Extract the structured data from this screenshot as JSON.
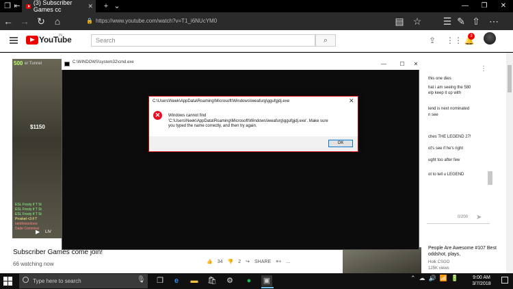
{
  "browser": {
    "tab_title": "(3) Subscriber Games cc",
    "tab_close": "✕",
    "url": "https://www.youtube.com/watch?v=T1_i6NUcYM0",
    "icons": [
      "back-icon",
      "forward-icon",
      "refresh-icon",
      "home-icon",
      "reading-view-icon",
      "favorites-icon",
      "favorites-hub-icon",
      "pen-icon",
      "share-icon",
      "more-icon"
    ]
  },
  "youtube": {
    "logo_text": "YouTube",
    "region": "IN",
    "search_placeholder": "Search",
    "notification_count": "3",
    "video_title": "Subscriber Games come join!",
    "watching": "66 watching now",
    "likes": "34",
    "dislikes": "2",
    "share_label": "SHARE",
    "more": "...",
    "overlay": {
      "tag": "500",
      "corner": "er Tunnel",
      "money": "$1150",
      "live": "LIV",
      "killfeed": [
        "ESL Frosty if T St",
        "ESL Frosty if T St",
        "ESL Frosty if T St",
        "Prosket <3 if T",
        "iamthesoolooo",
        "Dade Commissi"
      ]
    },
    "chat": {
      "lines": [
        "this one dies",
        "hat i am seeing the 580",
        "elp keep it up with",
        "lend is next nominated",
        "n see",
        "ches THE LEGEND 27!",
        "ot's see if he's right",
        "ught too after few",
        "ot to tell u LEGEND"
      ],
      "count": "0/200"
    },
    "recommended": {
      "title": "People Are Awesome #107 Best oddshot, plays,",
      "channel": "Holk CSGO",
      "views": "125K views"
    }
  },
  "cmd": {
    "title": "C:\\WINDOWS\\system32\\cmd.exe"
  },
  "dialog": {
    "title": "C:\\Users\\Neek\\AppData\\Roaming\\Microsoft\\Windows\\iweafurg\\ggufgjdj.exe",
    "message_line1": "Windows cannot find",
    "message_line2": "'C:\\Users\\Neek\\AppData\\Roaming\\Microsoft\\Windows\\iweafurg\\ggufgjdj.exe'. Make sure",
    "message_line3": "you typed the name correctly, and then try again.",
    "ok_label": "OK"
  },
  "taskbar": {
    "search_placeholder": "Type here to search",
    "time": "9:00 AM",
    "date": "3/7/2018",
    "colors": {
      "accent": "#76b9ed",
      "error": "#e81123",
      "youtube_red": "#ee0000"
    }
  }
}
